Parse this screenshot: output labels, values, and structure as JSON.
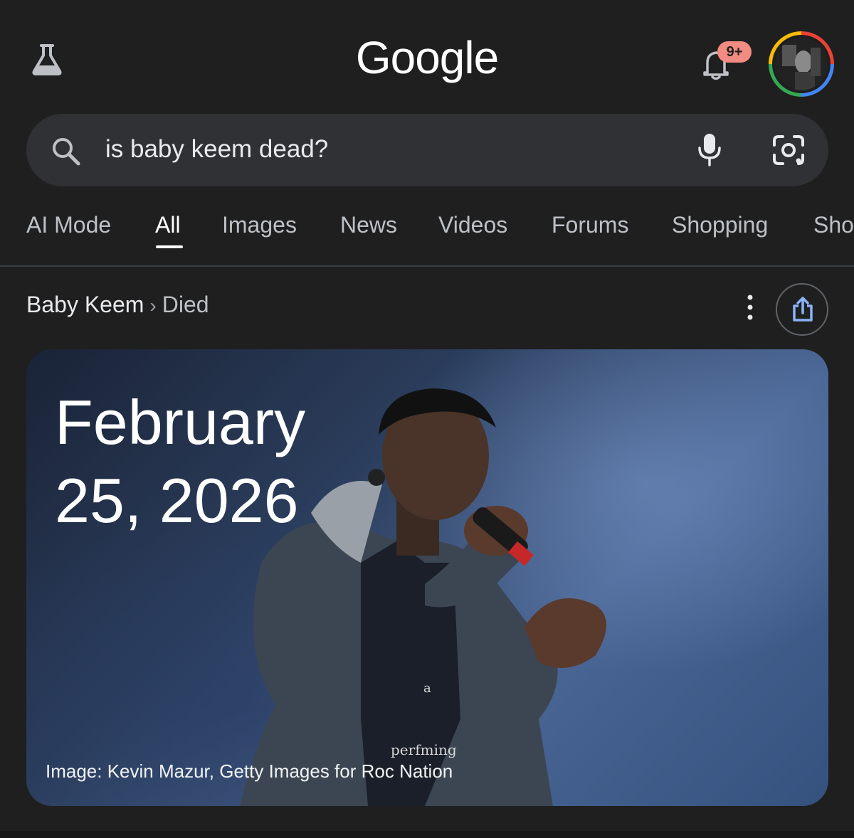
{
  "header": {
    "logo": "Google",
    "labs_icon": "flask-icon",
    "notification_icon": "bell-icon",
    "notification_badge": "9+",
    "avatar_icon": "account-avatar"
  },
  "search": {
    "query": "is baby keem dead?",
    "left_icon": "search-icon",
    "voice_icon": "mic-icon",
    "lens_icon": "google-lens-icon"
  },
  "tabs": [
    {
      "label": "AI Mode",
      "active": false
    },
    {
      "label": "All",
      "active": true
    },
    {
      "label": "Images",
      "active": false
    },
    {
      "label": "News",
      "active": false
    },
    {
      "label": "Videos",
      "active": false
    },
    {
      "label": "Forums",
      "active": false
    },
    {
      "label": "Shopping",
      "active": false
    },
    {
      "label": "Sho",
      "active": false
    }
  ],
  "breadcrumb": {
    "entity": "Baby Keem",
    "separator": "›",
    "attribute": "Died"
  },
  "actions": {
    "more_icon": "more-vert-icon",
    "share_icon": "share-icon"
  },
  "answer_card": {
    "date_line_1": "February",
    "date_line_2": "25, 2026",
    "photo_shirt_text_1": "a",
    "photo_shirt_text_2": "perfming",
    "caption": "Image: Kevin Mazur, Getty Images for Roc Nation"
  },
  "colors": {
    "background": "#1f1f1f",
    "search_bg": "#303134",
    "badge": "#f28b82",
    "text_primary": "#e8eaed",
    "text_secondary": "#bdc1c6"
  }
}
